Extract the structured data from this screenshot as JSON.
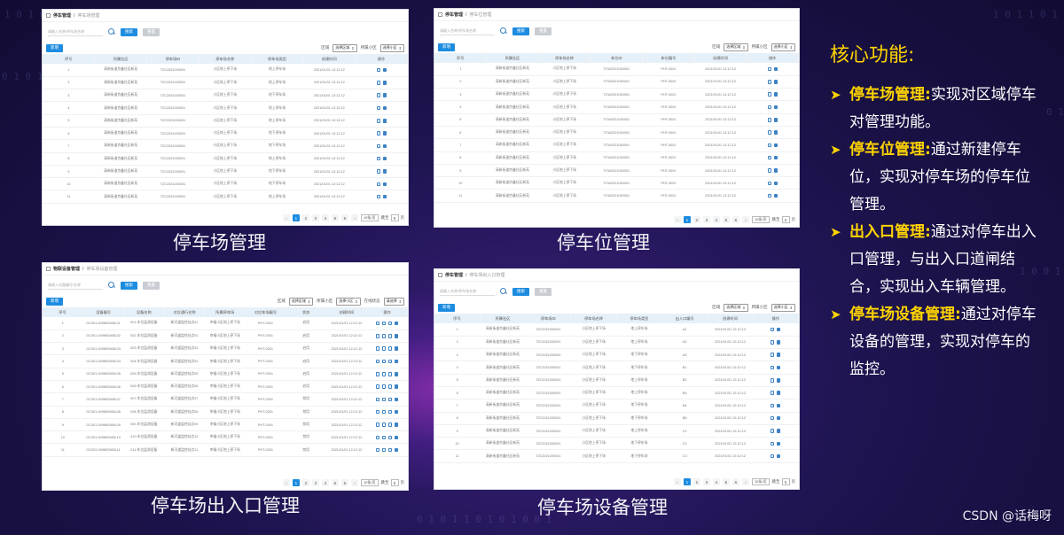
{
  "panels": {
    "p1": {
      "breadcrumb": [
        "停车管理",
        "停车场管理"
      ],
      "search_placeholder": "请输入名称/停车场名称",
      "btn_search": "搜索",
      "btn_reset": "重置",
      "btn_add": "新增",
      "filters": [
        {
          "label": "区域",
          "value": "选择区域"
        },
        {
          "label": "所属小区",
          "value": "选择小区"
        }
      ],
      "headers": [
        "序号",
        "所属社区",
        "停车场ID",
        "停车场名称",
        "停车场类型",
        "创建时间",
        "操作"
      ],
      "rows": [
        [
          "1",
          "高新街道京鑫社区新苑",
          "TZC2021000001",
          "小区地上停下场",
          "地上停车场",
          "2021/01/01 12:12:12"
        ],
        [
          "2",
          "高新街道京鑫社区新苑",
          "TZC2021000001",
          "小区地上停下场",
          "地上停车场",
          "2021/01/01 12:12:12"
        ],
        [
          "3",
          "高新街道京鑫社区新苑",
          "TZC2021000001",
          "小区地上停下场",
          "地下停车场",
          "2021/01/01 12:12:12"
        ],
        [
          "4",
          "高新街道京鑫社区新苑",
          "TZC2021000001",
          "小区地上停下场",
          "地上停车场",
          "2021/01/01 12:12:12"
        ],
        [
          "5",
          "高新街道京鑫社区新苑",
          "TZC2021000001",
          "小区地上停下场",
          "地上停车场",
          "2021/01/01 12:12:12"
        ],
        [
          "6",
          "高新街道京鑫社区新苑",
          "TZC2021000001",
          "小区地上停下场",
          "地下停车场",
          "2021/01/01 12:12:12"
        ],
        [
          "7",
          "高新街道京鑫社区新苑",
          "TZC2021000001",
          "小区地上停下场",
          "地下停车场",
          "2021/01/01 12:12:12"
        ],
        [
          "8",
          "高新街道京鑫社区新苑",
          "TZC2021000001",
          "小区地上停下场",
          "地上停车场",
          "2021/01/01 12:12:12"
        ],
        [
          "9",
          "高新街道京鑫社区新苑",
          "TZC2021000001",
          "小区地上停下场",
          "地下停车场",
          "2021/01/01 12:12:12"
        ],
        [
          "10",
          "高新街道京鑫社区新苑",
          "TZC2021000001",
          "小区地上停下场",
          "地下停车场",
          "2021/01/01 12:12:12"
        ],
        [
          "11",
          "高新街道京鑫社区新苑",
          "TZC2021000001",
          "小区地上停下场",
          "地上停车场",
          "2021/01/01 12:12:12"
        ]
      ],
      "pages": [
        "1",
        "2",
        "3",
        "4",
        "5",
        "6"
      ],
      "page_size": "10条/页",
      "goto_label": "跳至",
      "goto_value": "5",
      "goto_suffix": "页"
    },
    "p2": {
      "breadcrumb": [
        "停车管理",
        "停车位管理"
      ],
      "search_placeholder": "请输入名称/停车场名称",
      "btn_search": "搜索",
      "btn_reset": "重置",
      "btn_add": "新增",
      "filters": [
        {
          "label": "区域",
          "value": "选择区域"
        },
        {
          "label": "所属小区",
          "value": "选择小区"
        }
      ],
      "headers": [
        "序号",
        "所属社区",
        "停车场名称",
        "车位ID",
        "车位编号",
        "创建时间",
        "操作"
      ],
      "rows": [
        [
          "1",
          "高新街道京鑫社区新苑",
          "小区地上停下场",
          "TCW2021000001",
          "PHT-0001",
          "2021/01/01 12:12:12"
        ],
        [
          "2",
          "高新街道京鑫社区新苑",
          "小区地上停下场",
          "TCW2021000001",
          "PHT-0002",
          "2021/01/01 12:12:12"
        ],
        [
          "3",
          "高新街道京鑫社区新苑",
          "小区地上停下场",
          "TCW2021000001",
          "PHT-0001",
          "2021/01/01 12:12:12"
        ],
        [
          "4",
          "高新街道京鑫社区新苑",
          "小区地上停下场",
          "TCW2021000001",
          "PHT-0001",
          "2021/01/01 12:12:12"
        ],
        [
          "5",
          "高新街道京鑫社区新苑",
          "小区地上停下场",
          "TCW2021000001",
          "PHT-0001",
          "2021/01/01 12:12:12"
        ],
        [
          "6",
          "高新街道京鑫社区新苑",
          "小区地上停下场",
          "TCW2021000001",
          "PHT-0001",
          "2021/01/01 12:12:12"
        ],
        [
          "7",
          "高新街道京鑫社区新苑",
          "小区地上停下场",
          "TCW2021000001",
          "PHT-0001",
          "2021/01/01 12:12:12"
        ],
        [
          "8",
          "高新街道京鑫社区新苑",
          "小区地上停下场",
          "TCW2021000001",
          "PHT-0001",
          "2021/01/01 12:12:12"
        ],
        [
          "9",
          "高新街道京鑫社区新苑",
          "小区地上停下场",
          "TCW2021000001",
          "PHT-0001",
          "2021/01/01 12:12:12"
        ],
        [
          "10",
          "高新街道京鑫社区新苑",
          "小区地上停下场",
          "TCW2021000001",
          "PHT-0001",
          "2021/01/01 12:12:12"
        ],
        [
          "11",
          "高新街道京鑫社区新苑",
          "小区地上停下场",
          "TCW2021000001",
          "PHT-0001",
          "2021/01/01 12:12:12"
        ]
      ],
      "pages": [
        "1",
        "2",
        "3",
        "4",
        "5",
        "6"
      ],
      "page_size": "10条/页",
      "goto_label": "跳至",
      "goto_value": "5",
      "goto_suffix": "页"
    },
    "p3": {
      "breadcrumb": [
        "物联设备管理",
        "停车场设备管理"
      ],
      "search_placeholder": "请输入设备编号/名称",
      "btn_search": "搜索",
      "btn_reset": "重置",
      "btn_add": "新增",
      "filters": [
        {
          "label": "区域",
          "value": "选择区域"
        },
        {
          "label": "所属小区",
          "value": "选择小区"
        },
        {
          "label": "在线状态",
          "value": "请选择"
        }
      ],
      "headers": [
        "序号",
        "设备编号",
        "设备名称",
        "对应通行名称",
        "所属停车场",
        "对应车场编号",
        "状态",
        "创建时间",
        "操作"
      ],
      "rows": [
        [
          "1",
          "GC001-009890365L01",
          "001-车位监测设备",
          "新河道监控站点01",
          "幸福小区地上停下场",
          "PHT-0001",
          "启用",
          "2021/01/01 12:12:12"
        ],
        [
          "2",
          "GC001-009890365L02",
          "002-车位监测设备",
          "新河道监控站点02",
          "幸福小区地上停下场",
          "PHT-0001",
          "启用",
          "2021/01/01 12:12:12"
        ],
        [
          "3",
          "GC001-009890365L03",
          "003-车位监测设备",
          "新河道监控站点03",
          "幸福小区地上停下场",
          "PHT-0001",
          "启用",
          "2021/01/01 12:12:12"
        ],
        [
          "4",
          "GC001-009890365L04",
          "004-车位监测设备",
          "新河道监控站点04",
          "幸福小区地上停下场",
          "PHT-0001",
          "启用",
          "2021/01/01 12:12:12"
        ],
        [
          "5",
          "GC001-009890365L05",
          "005-车位监测设备",
          "新河道监控站点05",
          "幸福小区地上停下场",
          "PHT-0001",
          "启用",
          "2021/01/01 12:12:12"
        ],
        [
          "6",
          "GC001-009890365L06",
          "006-车位监测设备",
          "新河道监控站点06",
          "幸福小区地上停下场",
          "PHT-0001",
          "启用",
          "2021/01/01 12:12:12"
        ],
        [
          "7",
          "GC001-009890365L07",
          "007-车位监测设备",
          "新河道监控站点07",
          "幸福小区地上停下场",
          "PHT-0001",
          "禁用",
          "2021/01/01 12:12:12"
        ],
        [
          "8",
          "GC001-009890365L08",
          "008-车位监测设备",
          "新河道监控站点08",
          "幸福小区地上停下场",
          "PHT-0001",
          "禁用",
          "2021/01/01 12:12:12"
        ],
        [
          "9",
          "GC001-009890365L09",
          "009-车位监测设备",
          "新河道监控站点09",
          "幸福小区地上停下场",
          "PHT-0001",
          "禁用",
          "2021/01/01 12:12:12"
        ],
        [
          "10",
          "GC001-009890365L10",
          "010-车位监测设备",
          "新河道监控站点10",
          "幸福小区地上停下场",
          "PHT-0001",
          "禁用",
          "2021/01/01 12:12:12"
        ],
        [
          "11",
          "GC001-009890365L11",
          "011-车位监测设备",
          "新河道监控站点11",
          "幸福小区地上停下场",
          "PHT-0001",
          "禁用",
          "2021/01/01 12:12:12"
        ]
      ],
      "pages": [
        "1",
        "2",
        "3",
        "4",
        "5",
        "6"
      ],
      "page_size": "10条/页",
      "goto_label": "跳至",
      "goto_value": "5",
      "goto_suffix": "页"
    },
    "p4": {
      "breadcrumb": [
        "停车管理",
        "停车场出入口管理"
      ],
      "search_placeholder": "请输入名称/停车场名称",
      "btn_search": "搜索",
      "btn_reset": "重置",
      "btn_add": "新增",
      "filters": [
        {
          "label": "区域",
          "value": "选择区域"
        },
        {
          "label": "所属小区",
          "value": "选择小区"
        }
      ],
      "headers": [
        "序号",
        "所属社区",
        "停车场ID",
        "停车场名称",
        "停车场类型",
        "出入口编号",
        "创建时间",
        "操作"
      ],
      "rows": [
        [
          "1",
          "高新街道京鑫社区新苑",
          "TZC2021000001",
          "小区地上停下场",
          "地上停车场",
          "A1",
          "2021/01/01 12:12:12"
        ],
        [
          "2",
          "高新街道京鑫社区新苑",
          "TZC2021000001",
          "小区地上停下场",
          "地上停车场",
          "A2",
          "2021/01/01 12:12:12"
        ],
        [
          "3",
          "高新街道京鑫社区新苑",
          "TZC2021000001",
          "小区地上停下场",
          "地下停车场",
          "A3",
          "2021/01/01 12:12:12"
        ],
        [
          "4",
          "高新街道京鑫社区新苑",
          "TZC2021000001",
          "小区地上停下场",
          "地下停车场",
          "B1",
          "2021/01/01 12:12:12"
        ],
        [
          "5",
          "高新街道京鑫社区新苑",
          "TZC2021000001",
          "小区地上停下场",
          "地上停车场",
          "B2",
          "2021/01/01 12:12:12"
        ],
        [
          "6",
          "高新街道京鑫社区新苑",
          "TZC2021000001",
          "小区地上停下场",
          "地上停车场",
          "B3",
          "2021/01/01 12:12:12"
        ],
        [
          "7",
          "高新街道京鑫社区新苑",
          "TZC2021000001",
          "小区地上停下场",
          "地下停车场",
          "B4",
          "2021/01/01 12:12:12"
        ],
        [
          "8",
          "高新街道京鑫社区新苑",
          "TZC2021000001",
          "小区地上停下场",
          "地下停车场",
          "B5",
          "2021/01/01 12:12:12"
        ],
        [
          "9",
          "高新街道京鑫社区新苑",
          "TZC2021000001",
          "小区地上停下场",
          "地上停车场",
          "C1",
          "2021/01/01 12:12:12"
        ],
        [
          "10",
          "高新街道京鑫社区新苑",
          "TZC2021000001",
          "小区地上停下场",
          "地下停车场",
          "C2",
          "2021/01/01 12:12:12"
        ],
        [
          "11",
          "高新街道京鑫社区新苑",
          "TZC2021000001",
          "小区地上停下场",
          "地下停车场",
          "C3",
          "2021/01/01 12:12:12"
        ]
      ],
      "pages": [
        "1",
        "2",
        "3",
        "4",
        "5",
        "6"
      ],
      "page_size": "10条/页",
      "goto_label": "跳至",
      "goto_value": "5",
      "goto_suffix": "页"
    }
  },
  "captions": {
    "p1": "停车场管理",
    "p2": "停车位管理",
    "p3": "停车场出入口管理",
    "p4": "停车场设备管理"
  },
  "features": {
    "title": "核心功能:",
    "items": [
      {
        "name": "停车场管理:",
        "desc": "实现对区域停车对管理功能。"
      },
      {
        "name": "停车位管理:",
        "desc": "通过新建停车位，实现对停车场的停车位管理。"
      },
      {
        "name": "出入口管理:",
        "desc": "通过对停车出入口管理，与出入口道闸结合，实现出入车辆管理。"
      },
      {
        "name": "停车场设备管理:",
        "desc": "通过对停车设备的管理，实现对停车的监控。"
      }
    ]
  },
  "watermark": "CSDN @话梅呀",
  "colors": {
    "accent": "#ffd400",
    "primary_button": "#1d8ce0",
    "table_header": "#e6f0f8",
    "background": "#1e1450"
  }
}
